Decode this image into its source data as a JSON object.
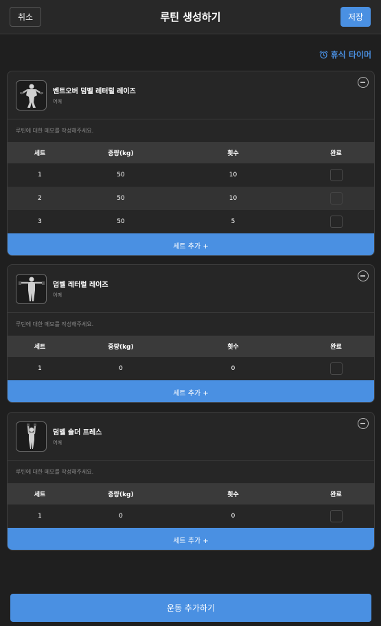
{
  "header": {
    "cancel_label": "취소",
    "title": "루틴 생성하기",
    "save_label": "저장"
  },
  "rest_timer": {
    "label": "휴식 타이머",
    "icon": "alarm-clock-icon"
  },
  "colors": {
    "accent": "#4a90e2",
    "background": "#1f1f1f",
    "card": "#262626"
  },
  "table_headers": {
    "set": "세트",
    "weight": "중량(kg)",
    "reps": "횟수",
    "done": "완료"
  },
  "memo_placeholder": "루틴에 대한 메모를 작성해주세요.",
  "add_set_label": "세트 추가 +",
  "exercises": [
    {
      "name": "벤트오버 덤벨 레터럴 레이즈",
      "part": "어깨",
      "sets": [
        {
          "set": "1",
          "weight": "50",
          "reps": "10",
          "done": false
        },
        {
          "set": "2",
          "weight": "50",
          "reps": "10",
          "done": false
        },
        {
          "set": "3",
          "weight": "50",
          "reps": "5",
          "done": false
        }
      ]
    },
    {
      "name": "덤벨 레터럴 레이즈",
      "part": "어깨",
      "sets": [
        {
          "set": "1",
          "weight": "0",
          "reps": "0",
          "done": false
        }
      ]
    },
    {
      "name": "덤벨 숄더 프레스",
      "part": "어깨",
      "sets": [
        {
          "set": "1",
          "weight": "0",
          "reps": "0",
          "done": false
        }
      ]
    }
  ],
  "add_exercise_label": "운동 추가하기"
}
